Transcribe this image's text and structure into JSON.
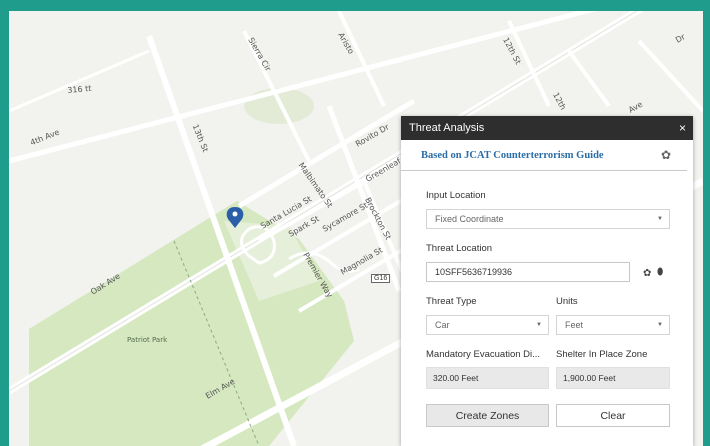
{
  "map": {
    "street_labels": [
      "316 tt",
      "4th Ave",
      "13th St",
      "Aristo",
      "Sierra Cir",
      "Rovito Dr",
      "Greenleaf Ln",
      "Malbimato St",
      "Santa Lucia St",
      "Spark St",
      "Sycamore St",
      "Brockton St",
      "Premier Way",
      "Magnolia St",
      "Oak Ave",
      "Patriot Park",
      "Elm Ave",
      "12th St",
      "12th",
      "Ave",
      "Dr"
    ],
    "route_shield": "G16",
    "colors": {
      "park": "#d5e8c0",
      "road": "#ffffff",
      "background": "#f2f2ee",
      "marker": "#2a5ea8"
    }
  },
  "panel": {
    "title": "Threat Analysis",
    "close": "×",
    "subtitle": "Based on JCAT Counterterrorism Guide",
    "input_location_label": "Input Location",
    "input_location_value": "Fixed Coordinate",
    "threat_location_label": "Threat Location",
    "threat_location_value": "10SFF5636719936",
    "threat_type_label": "Threat Type",
    "threat_type_value": "Car",
    "units_label": "Units",
    "units_value": "Feet",
    "evac_label": "Mandatory Evacuation Di...",
    "evac_value": "320.00 Feet",
    "shelter_label": "Shelter In Place Zone",
    "shelter_value": "1,900.00 Feet",
    "create_label": "Create Zones",
    "clear_label": "Clear",
    "caret": "▼",
    "gear_glyph": "✿",
    "pin_glyph": "⬮",
    "accent": "#2b6da6"
  }
}
